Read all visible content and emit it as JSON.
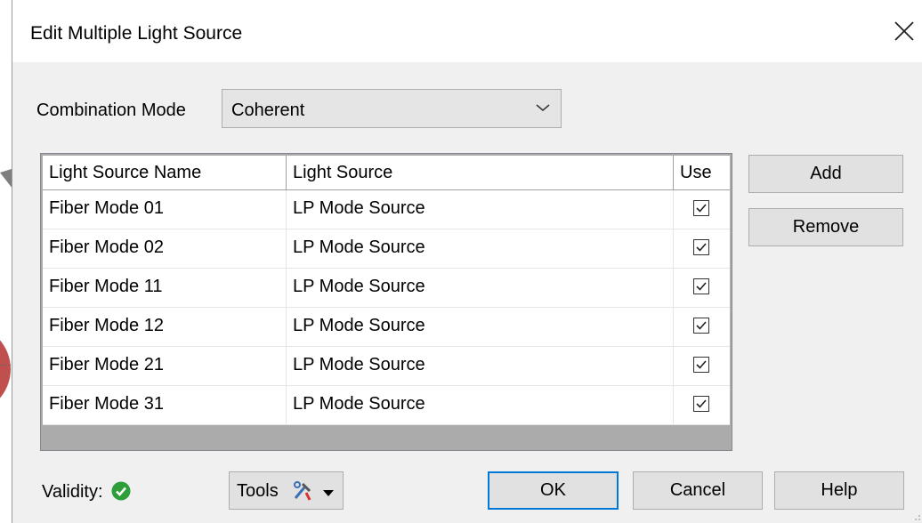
{
  "dialog": {
    "title": "Edit Multiple Light Source"
  },
  "combination_mode": {
    "label": "Combination Mode",
    "value": "Coherent"
  },
  "grid": {
    "columns": [
      "Light Source Name",
      "Light Source",
      "Use"
    ],
    "rows": [
      {
        "name": "Fiber Mode 01",
        "source": "LP Mode Source",
        "use": true
      },
      {
        "name": "Fiber Mode 02",
        "source": "LP Mode Source",
        "use": true
      },
      {
        "name": "Fiber Mode 11",
        "source": "LP Mode Source",
        "use": true
      },
      {
        "name": "Fiber Mode 12",
        "source": "LP Mode Source",
        "use": true
      },
      {
        "name": "Fiber Mode 21",
        "source": "LP Mode Source",
        "use": true
      },
      {
        "name": "Fiber Mode 31",
        "source": "LP Mode Source",
        "use": true
      }
    ]
  },
  "side_buttons": {
    "add": "Add",
    "remove": "Remove"
  },
  "footer": {
    "validity_label": "Validity:",
    "validity_status": "valid",
    "tools": "Tools",
    "ok": "OK",
    "cancel": "Cancel",
    "help": "Help"
  },
  "colors": {
    "validity_green": "#2e9e3a",
    "ok_border": "#0078d7"
  },
  "icons": [
    "close-icon",
    "chevron-down-icon",
    "checkmark-icon",
    "valid-check-icon",
    "tools-icon",
    "dropdown-caret-icon"
  ]
}
